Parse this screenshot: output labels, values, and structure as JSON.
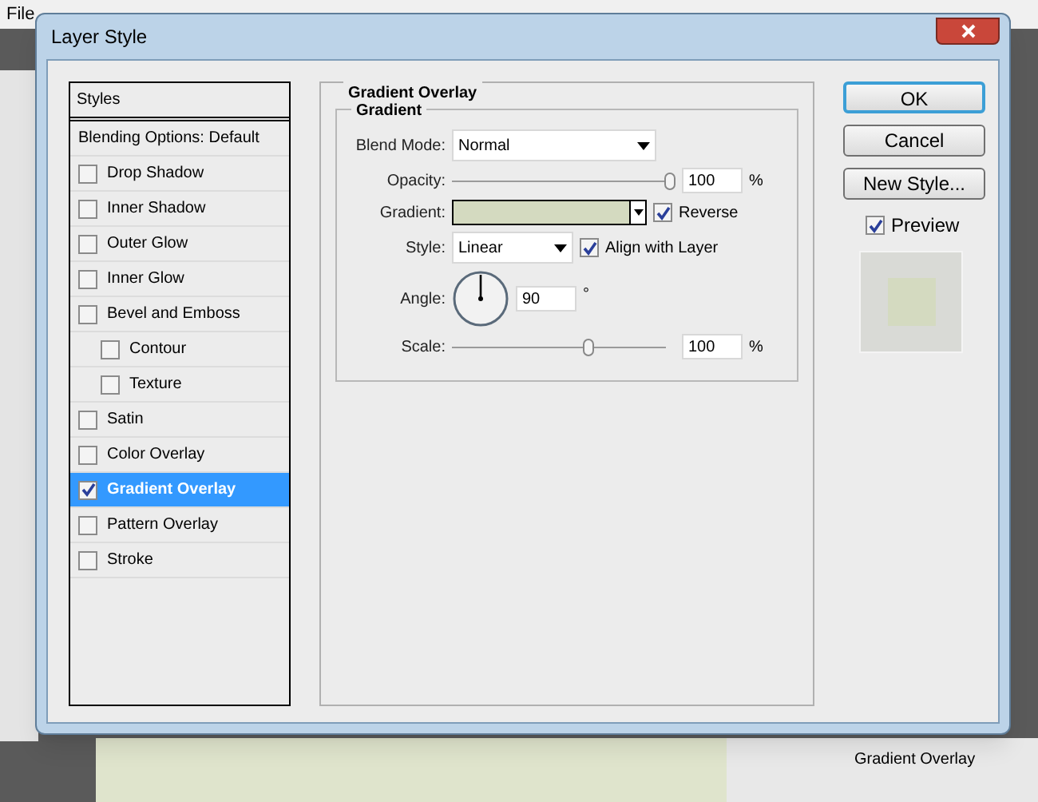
{
  "app": {
    "menu": [
      "File"
    ],
    "layers_panel_item": "Gradient Overlay"
  },
  "window": {
    "title": "Layer Style"
  },
  "styles_list": {
    "header": "Styles",
    "items": [
      {
        "label": "Blending Options: Default",
        "kind": "plain",
        "selected": false
      },
      {
        "label": "Drop Shadow",
        "kind": "check",
        "checked": false,
        "selected": false
      },
      {
        "label": "Inner Shadow",
        "kind": "check",
        "checked": false,
        "selected": false
      },
      {
        "label": "Outer Glow",
        "kind": "check",
        "checked": false,
        "selected": false
      },
      {
        "label": "Inner Glow",
        "kind": "check",
        "checked": false,
        "selected": false
      },
      {
        "label": "Bevel and Emboss",
        "kind": "check",
        "checked": false,
        "selected": false,
        "children": [
          {
            "label": "Contour",
            "kind": "check",
            "checked": false,
            "selected": false
          },
          {
            "label": "Texture",
            "kind": "check",
            "checked": false,
            "selected": false
          }
        ]
      },
      {
        "label": "Satin",
        "kind": "check",
        "checked": false,
        "selected": false
      },
      {
        "label": "Color Overlay",
        "kind": "check",
        "checked": false,
        "selected": false
      },
      {
        "label": "Gradient Overlay",
        "kind": "check",
        "checked": true,
        "selected": true
      },
      {
        "label": "Pattern Overlay",
        "kind": "check",
        "checked": false,
        "selected": false
      },
      {
        "label": "Stroke",
        "kind": "check",
        "checked": false,
        "selected": false
      }
    ]
  },
  "panel": {
    "title": "Gradient Overlay",
    "group": "Gradient",
    "blend_mode": {
      "label": "Blend Mode:",
      "value": "Normal"
    },
    "opacity": {
      "label": "Opacity:",
      "level": 1,
      "value": "100",
      "unit": "%"
    },
    "gradient": {
      "label": "Gradient:",
      "color": "#d4dac0",
      "reverse": {
        "label": "Reverse",
        "checked": true
      }
    },
    "style": {
      "label": "Style:",
      "value": "Linear",
      "align": {
        "label": "Align with Layer",
        "checked": true
      }
    },
    "angle": {
      "label": "Angle:",
      "value": "90",
      "unit": "°"
    },
    "scale": {
      "label": "Scale:",
      "level": 0.62,
      "value": "100",
      "unit": "%"
    }
  },
  "buttons": [
    {
      "label": "OK",
      "default": true
    },
    {
      "label": "Cancel",
      "default": false
    },
    {
      "label": "New Style...",
      "default": false
    }
  ],
  "preview": {
    "label": "Preview",
    "checked": true
  }
}
